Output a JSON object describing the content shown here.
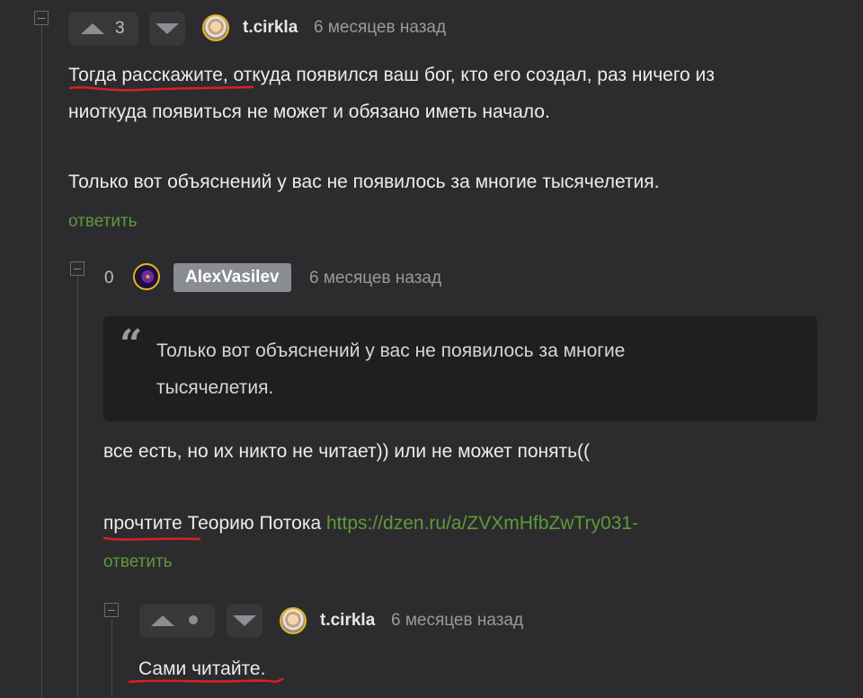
{
  "comments": [
    {
      "votes": "3",
      "username": "t.cirkla",
      "time": "6 месяцев назад",
      "lines": [
        "Тогда расскажите, откуда появился ваш бог, кто его создал, раз ничего из",
        "ниоткуда появиться не может и обязано иметь начало.",
        "Только вот объяснений у вас не появилось за многие тысячелетия."
      ],
      "reply": "ответить"
    },
    {
      "votes": "0",
      "username": "AlexVasilev",
      "time": "6 месяцев назад",
      "quote_lines": [
        "Только вот объяснений у вас не появилось за многие",
        "тысячелетия."
      ],
      "line1": "все есть, но их никто не читает)) или не может понять((",
      "line2_prefix": "прочтите Теорию Потока ",
      "link": "https://dzen.ru/a/ZVXmHfbZwTry031-",
      "reply": "ответить"
    },
    {
      "username": "t.cirkla",
      "time": "6 месяцев назад",
      "text": "Сами читайте."
    }
  ],
  "colors": {
    "background": "#2c2c2e",
    "link": "#5f9a3a",
    "annotation": "#d92020",
    "avatar_border": "#e8b422"
  },
  "icons": [
    "collapse-icon",
    "upvote-icon",
    "downvote-icon",
    "avatar-icon",
    "quote-icon",
    "no-votes-dot-icon"
  ]
}
